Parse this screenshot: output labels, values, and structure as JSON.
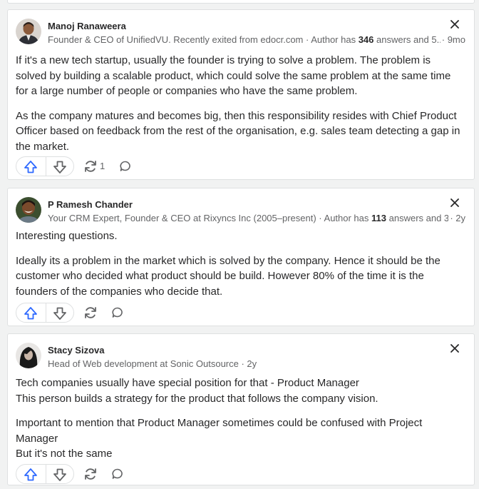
{
  "answers": [
    {
      "author": "Manoj Ranaweera",
      "credential_pre": "Founder & CEO of UnifiedVU. Recently exited from edocr.com · Author has ",
      "answers_count": "346",
      "credential_post": " answers and 5...",
      "ago": " · 9mo",
      "paragraphs": [
        "If it's a new tech startup, usually the founder is trying to solve a problem. The problem is solved by building a scalable product, which could solve the same problem at the same time for a large number of people or companies who have the same problem.",
        "As the company matures and becomes big, then this responsibility resides with Chief Product Officer based on feedback from the rest of the organisation, e.g. sales team detecting a gap in the market."
      ],
      "share_count": "1"
    },
    {
      "author": "P Ramesh Chander",
      "credential_pre": "Your CRM Expert, Founder & CEO at Rixyncs Inc (2005–present) · Author has ",
      "answers_count": "113",
      "credential_post": " answers and 38...",
      "ago": " · 2y",
      "paragraphs": [
        "Interesting questions.",
        "Ideally its a problem in the market which is solved by the company. Hence it should be the customer who decided what product should be build. However 80% of the time it is the founders of the companies who decide that."
      ],
      "share_count": ""
    },
    {
      "author": "Stacy Sizova",
      "credential_pre": "Head of Web development at Sonic Outsource · 2y",
      "answers_count": "",
      "credential_post": "",
      "ago": "",
      "paragraphs": [
        "Tech companies usually have special position for that - Product Manager\nThis person builds a strategy for the product that follows the company vision.",
        "Important to mention that Product Manager sometimes could be confused with Project Manager\nBut it's not the same"
      ],
      "share_count": ""
    }
  ],
  "icons": {
    "close": "close-icon",
    "upvote": "upvote-arrow-icon",
    "downvote": "downvote-arrow-icon",
    "share": "reshare-icon",
    "comment": "comment-icon"
  },
  "colors": {
    "upvote_blue": "#2e69ff",
    "text": "#282829",
    "muted": "#636466",
    "border": "#dee0e1",
    "background": "#f1f2f2"
  }
}
